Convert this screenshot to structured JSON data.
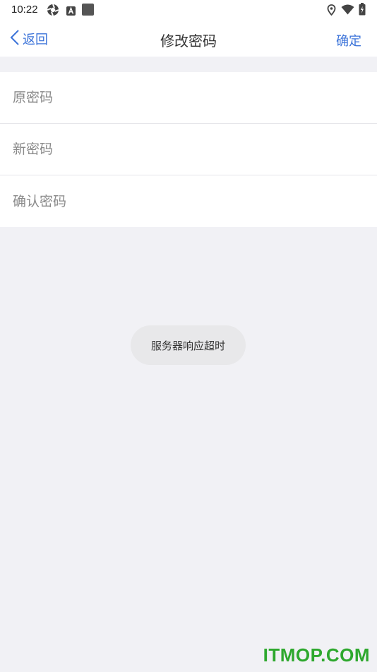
{
  "status_bar": {
    "time": "10:22",
    "icons": [
      "aperture-icon",
      "a-badge-icon",
      "square-icon",
      "location-icon",
      "wifi-icon",
      "battery-icon"
    ]
  },
  "nav": {
    "back_label": "返回",
    "title": "修改密码",
    "confirm_label": "确定",
    "accent_color": "#3b73d9"
  },
  "form": {
    "old_password": {
      "value": "",
      "placeholder": "原密码"
    },
    "new_password": {
      "value": "",
      "placeholder": "新密码"
    },
    "confirm_password": {
      "value": "",
      "placeholder": "确认密码"
    }
  },
  "toast": {
    "message": "服务器响应超时"
  },
  "watermark": {
    "text": "ITMOP.COM",
    "color": "#2ea82e"
  }
}
